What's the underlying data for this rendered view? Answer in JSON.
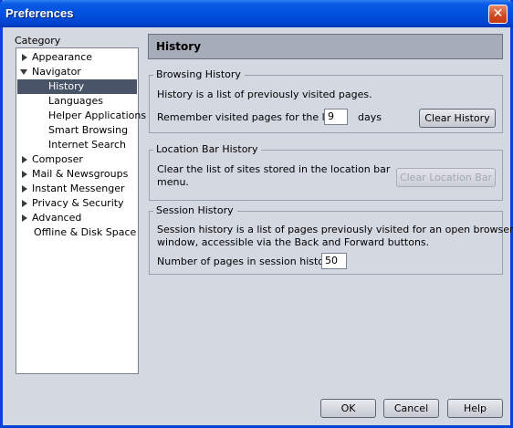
{
  "window": {
    "title": "Preferences",
    "close_glyph": "✕"
  },
  "category": {
    "label": "Category",
    "items": [
      {
        "label": "Appearance",
        "twisty": "right"
      },
      {
        "label": "Navigator",
        "twisty": "down"
      },
      {
        "label": "History",
        "selected": true
      },
      {
        "label": "Languages"
      },
      {
        "label": "Helper Applications"
      },
      {
        "label": "Smart Browsing"
      },
      {
        "label": "Internet Search"
      },
      {
        "label": "Composer",
        "twisty": "right"
      },
      {
        "label": "Mail & Newsgroups",
        "twisty": "right"
      },
      {
        "label": "Instant Messenger",
        "twisty": "right"
      },
      {
        "label": "Privacy & Security",
        "twisty": "right"
      },
      {
        "label": "Advanced",
        "twisty": "right"
      },
      {
        "label": "Offline & Disk Space"
      }
    ]
  },
  "panel": {
    "title": "History"
  },
  "browsing": {
    "title": "Browsing History",
    "desc": "History is a list of previously visited pages.",
    "remember_label": "Remember visited pages for the last",
    "days_value": "9",
    "days_unit": "days",
    "clear_button": "Clear History"
  },
  "location": {
    "title": "Location Bar History",
    "desc_line1": "Clear the list of sites stored in the location bar",
    "desc_line2": "menu.",
    "clear_button": "Clear Location Bar"
  },
  "session": {
    "title": "Session History",
    "desc_line1": "Session history is a list of pages previously visited for an open browser",
    "desc_line2": "window, accessible via the Back and Forward buttons.",
    "pages_label": "Number of pages in session history:",
    "pages_value": "50"
  },
  "footer": {
    "ok": "OK",
    "cancel": "Cancel",
    "help": "Help"
  },
  "colors": {
    "titlebar": "#0250de",
    "selection": "#4a5469",
    "panel_header": "#a7acb9"
  }
}
